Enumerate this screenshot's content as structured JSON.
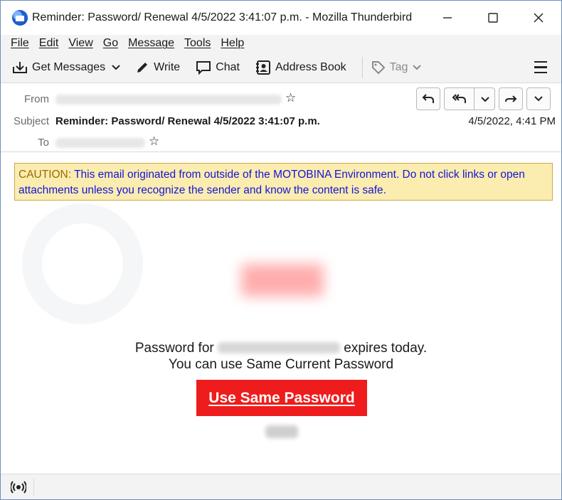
{
  "window": {
    "title": "Reminder: Password/ Renewal 4/5/2022 3:41:07 p.m. - Mozilla Thunderbird",
    "minimize_label": "—",
    "maximize_label": "☐",
    "close_label": "✕"
  },
  "menubar": {
    "items": [
      "File",
      "Edit",
      "View",
      "Go",
      "Message",
      "Tools",
      "Help"
    ]
  },
  "toolbar": {
    "get_messages_label": "Get Messages",
    "write_label": "Write",
    "chat_label": "Chat",
    "address_book_label": "Address Book",
    "tag_label": "Tag"
  },
  "header": {
    "from_label": "From",
    "subject_label": "Subject",
    "to_label": "To",
    "subject": "Reminder: Password/ Renewal 4/5/2022 3:41:07 p.m.",
    "date": "4/5/2022, 4:41 PM"
  },
  "body": {
    "caution_label": "CAUTION:",
    "caution_text": " This email originated from outside of the MOTOBINA Environment. Do not click links or open attachments unless you recognize the sender and know the content is safe.",
    "line1_prefix": "Password for ",
    "line1_suffix": " expires today.",
    "line2": "You can use Same Current Password",
    "cta_label": "Use Same Password"
  },
  "colors": {
    "cta_background": "#ee1c1c",
    "caution_background": "#fbecb0",
    "caution_text": "#1515d6"
  }
}
